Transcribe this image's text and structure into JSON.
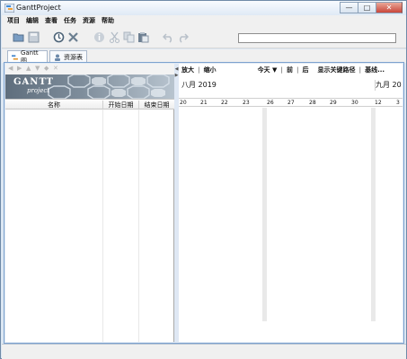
{
  "window": {
    "title": "GanttProject",
    "controls": {
      "minimize": "—",
      "maximize": "□",
      "close": "✕"
    }
  },
  "menu": [
    "项目",
    "编辑",
    "查看",
    "任务",
    "资源",
    "帮助"
  ],
  "toolbar": {
    "icons": [
      "open-folder-icon",
      "save-icon",
      "history-icon",
      "delete-icon",
      "info-icon",
      "cut-icon",
      "copy-icon",
      "paste-icon",
      "undo-icon",
      "redo-icon"
    ],
    "search_value": ""
  },
  "tabs": [
    {
      "label": "Gantt 图"
    },
    {
      "label": "资源表"
    }
  ],
  "left_panel": {
    "logo_text": "GANTT",
    "logo_sub": "project",
    "columns": [
      "名称",
      "开始日期",
      "结束日期"
    ]
  },
  "gantt": {
    "tools": [
      "放大",
      "缩小",
      "今天 ▼",
      "前",
      "后",
      "显示关键路径",
      "基线..."
    ],
    "months": [
      "八月 2019",
      "九月 20"
    ],
    "days": [
      "20",
      "21",
      "22",
      "23",
      "26",
      "27",
      "28",
      "29",
      "30",
      "12",
      "3"
    ]
  },
  "colors": {
    "accent": "#7da2ce",
    "window_bg": "#dce7f3",
    "weekend": "#e9e9e9"
  }
}
